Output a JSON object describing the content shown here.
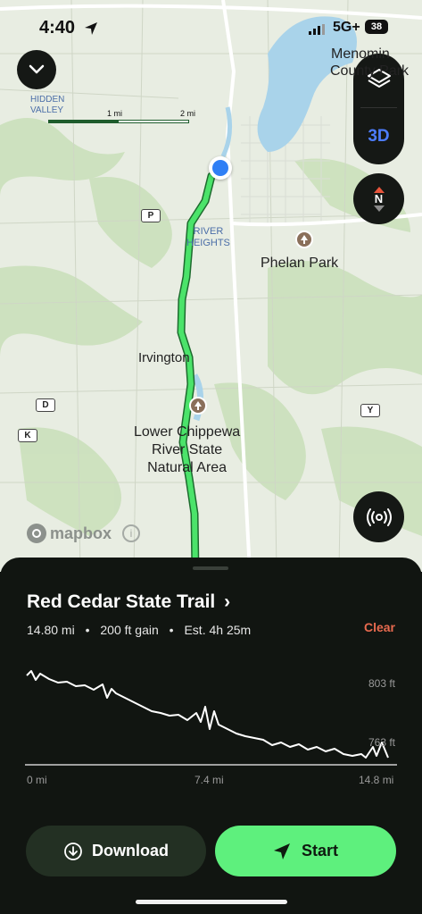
{
  "status_bar": {
    "time": "4:40",
    "network": "5G+",
    "battery": "38"
  },
  "map": {
    "labels": {
      "hidden_valley": "HIDDEN\nVALLEY",
      "menomonie": "Menomin",
      "county_park": "County Park",
      "river_heights": "RIVER\nHEIGHTS",
      "phelan_park": "Phelan Park",
      "irvington": "Irvington",
      "lower_chippewa": "Lower Chippewa\nRiver State\nNatural Area"
    },
    "road_badges": [
      "P",
      "D",
      "K",
      "Y"
    ],
    "scale": {
      "one": "1 mi",
      "two": "2 mi"
    },
    "attribution": "mapbox",
    "buttons": {
      "three_d": "3D",
      "compass_n": "N"
    }
  },
  "trail": {
    "name": "Red Cedar State Trail",
    "distance": "14.80 mi",
    "gain": "200 ft gain",
    "estimate": "Est. 4h 25m",
    "clear_label": "Clear"
  },
  "elevation": {
    "y_top_label": "803 ft",
    "y_bottom_label": "763 ft",
    "x_labels": [
      "0 mi",
      "7.4 mi",
      "14.8 mi"
    ]
  },
  "actions": {
    "download": "Download",
    "start": "Start"
  },
  "colors": {
    "route": "#4be36a",
    "start_button": "#5ef07d",
    "clear": "#e86a4f",
    "location_dot": "#2f7ff5",
    "water": "#a9d3ea"
  }
}
